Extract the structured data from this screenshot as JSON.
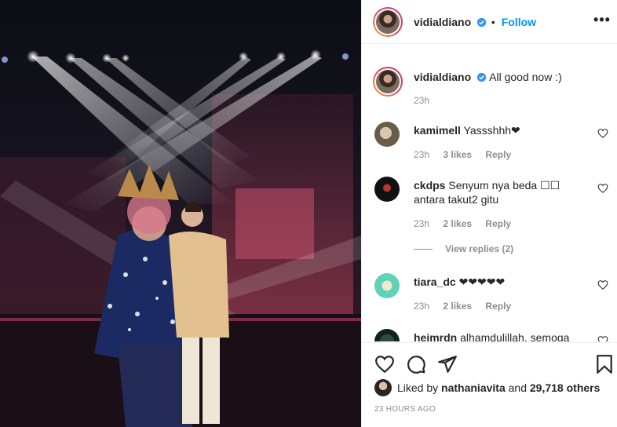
{
  "header": {
    "username": "vidialdiano",
    "separator": "•",
    "follow_label": "Follow",
    "more_label": "•••"
  },
  "caption": {
    "username": "vidialdiano",
    "text": "All good now :)",
    "time": "23h"
  },
  "comments": [
    {
      "username": "kamimell",
      "text": "Yassshhh❤",
      "time": "23h",
      "likes": "3 likes",
      "reply": "Reply"
    },
    {
      "username": "ckdps",
      "text": "Senyum nya beda ☐☐ antara takut2 gitu",
      "time": "23h",
      "likes": "2 likes",
      "reply": "Reply"
    },
    {
      "username": "tiara_dc",
      "text": "❤❤❤❤❤",
      "time": "23h",
      "likes": "2 likes",
      "reply": "Reply"
    },
    {
      "username": "heimrdn",
      "text": "alhamdulillah, semoga",
      "time": "",
      "likes": "",
      "reply": ""
    }
  ],
  "view_replies": "View replies (2)",
  "footer": {
    "liked_prefix": "Liked by",
    "liked_user": "nathaniavita",
    "liked_and": "and",
    "liked_count": "29,718 others",
    "timestamp": "23 HOURS AGO"
  },
  "icons": [
    "verified-icon",
    "more-icon",
    "heart-icon",
    "comment-icon",
    "share-icon",
    "bookmark-icon"
  ],
  "colors": {
    "link": "#0095f6",
    "verified": "#3897f0",
    "muted": "#8e8e8e"
  }
}
